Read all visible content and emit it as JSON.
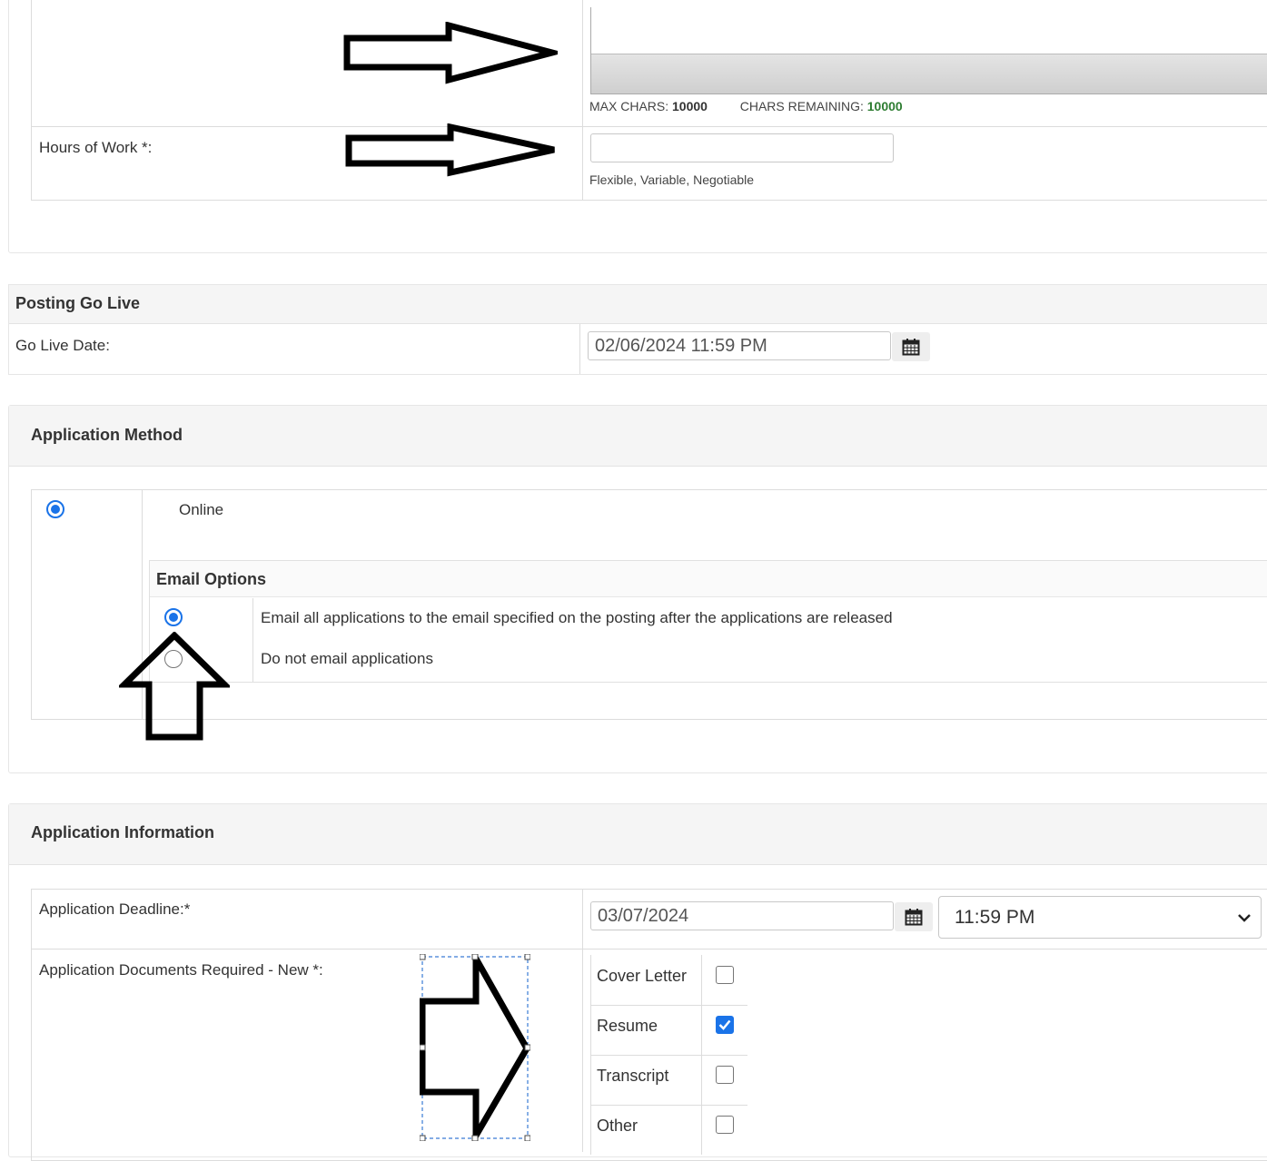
{
  "description_box": {
    "max_chars_label": "MAX CHARS:",
    "max_chars_value": "10000",
    "chars_remaining_label": "CHARS REMAINING:",
    "chars_remaining_value": "10000"
  },
  "hours_of_work": {
    "label": "Hours of Work *:",
    "value": "",
    "hint": "Flexible, Variable, Negotiable"
  },
  "posting_go_live": {
    "title": "Posting Go Live",
    "go_live_label": "Go Live Date:",
    "go_live_value": "02/06/2024 11:59 PM"
  },
  "application_method": {
    "title": "Application Method",
    "online_label": "Online",
    "online_selected": true,
    "email_options": {
      "title": "Email Options",
      "options": [
        {
          "label": "Email all applications to the email specified on the posting after the applications are released",
          "selected": true
        },
        {
          "label": "Do not email applications",
          "selected": false
        }
      ]
    }
  },
  "application_information": {
    "title": "Application Information",
    "deadline_label": "Application Deadline:*",
    "deadline_date": "03/07/2024",
    "deadline_time": "11:59 PM",
    "documents_label": "Application Documents Required - New *:",
    "documents": [
      {
        "label": "Cover Letter",
        "checked": false
      },
      {
        "label": "Resume",
        "checked": true
      },
      {
        "label": "Transcript",
        "checked": false
      },
      {
        "label": "Other",
        "checked": false
      }
    ]
  },
  "colors": {
    "accent": "#1a73e8",
    "chars_remaining": "#2e7d32",
    "panel_header": "#f5f5f5"
  },
  "icons": [
    "calendar-icon",
    "chevron-down-icon",
    "arrow-right-annotation",
    "arrow-up-annotation"
  ]
}
